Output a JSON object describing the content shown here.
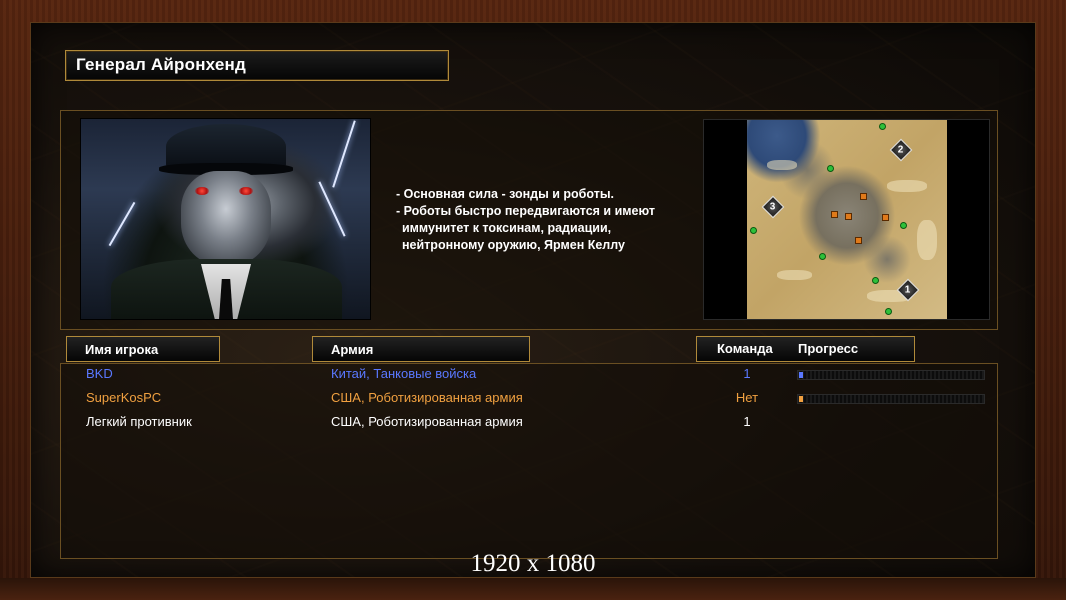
{
  "title": "Генерал Айронхенд",
  "general": {
    "description": [
      "- Основная сила - зонды и роботы.",
      "- Роботы быстро передвигаются и имеют",
      "иммунитет к токсинам, радиации,",
      "нейтронному оружию, Ярмен Келлу"
    ]
  },
  "minimap": {
    "start_positions": [
      "1",
      "2",
      "3"
    ]
  },
  "table": {
    "headers": {
      "player": "Имя игрока",
      "army": "Армия",
      "team": "Команда",
      "progress": "Прогресс"
    },
    "rows": [
      {
        "name": "BKD",
        "army": "Китай, Танковые войска",
        "team": "1",
        "color": "#5a78ff",
        "progress": 0.02
      },
      {
        "name": "SuperKosPC",
        "army": "США, Роботизированная армия",
        "team": "Нет",
        "color": "#f0a040",
        "progress": 0.02
      },
      {
        "name": "Легкий противник",
        "army": "США, Роботизированная армия",
        "team": "1",
        "color": "#ffffff",
        "progress": null
      }
    ]
  },
  "resolution_label": "1920 x 1080",
  "colors": {
    "frame_gold": "#b08a3a",
    "player_blue": "#5a78ff",
    "player_orange": "#f0a040"
  }
}
